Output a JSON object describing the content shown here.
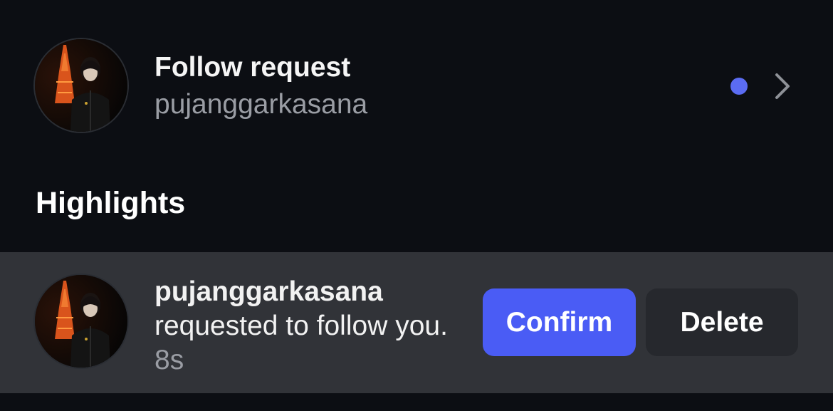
{
  "follow_request": {
    "title": "Follow request",
    "username": "pujanggarkasana",
    "unread_dot_color": "#5b6cf2",
    "icons": {
      "avatar": "avatar-image",
      "chevron": "chevron-right-icon"
    }
  },
  "highlights": {
    "heading": "Highlights",
    "items": [
      {
        "username": "pujanggarkasana",
        "message": "requested to follow you.",
        "time": "8s",
        "confirm_label": "Confirm",
        "delete_label": "Delete"
      }
    ]
  },
  "colors": {
    "background": "#0c0e13",
    "highlight_row": "#313338",
    "confirm_button": "#4a5cf5",
    "delete_button": "#26282d",
    "secondary_text": "#9a9da4"
  }
}
